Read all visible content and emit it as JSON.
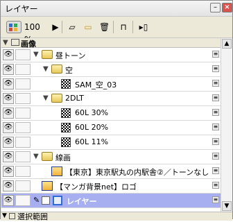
{
  "window": {
    "title": "レイヤー"
  },
  "toolbar": {
    "opacity": "100 %",
    "icons": [
      "layer-stack-icon",
      "play-arrow-icon",
      "new-layer-icon",
      "new-folder-icon",
      "trash-icon",
      "lock-icon",
      "export-icon"
    ]
  },
  "header": {
    "label": "画像"
  },
  "layers": [
    {
      "indent": 1,
      "type": "folder",
      "label": "昼トーン"
    },
    {
      "indent": 2,
      "type": "folder",
      "label": "空"
    },
    {
      "indent": 3,
      "type": "tone",
      "label": "SAM_空_03"
    },
    {
      "indent": 2,
      "type": "folder",
      "label": "2DLT"
    },
    {
      "indent": 3,
      "type": "tone",
      "label": "60L 30%"
    },
    {
      "indent": 3,
      "type": "tone",
      "label": "60L 20%"
    },
    {
      "indent": 3,
      "type": "tone",
      "label": "60L 11%"
    },
    {
      "indent": 1,
      "type": "folder",
      "label": "線画"
    },
    {
      "indent": 2,
      "type": "file",
      "label": "【東京】東京駅丸の内駅舎②／トーンなし"
    },
    {
      "indent": 1,
      "type": "file",
      "label": "【マンガ背景net】ロゴ"
    },
    {
      "indent": 1,
      "type": "layer",
      "label": "レイヤー",
      "selected": true
    }
  ],
  "footer": {
    "label": "選択範囲"
  }
}
